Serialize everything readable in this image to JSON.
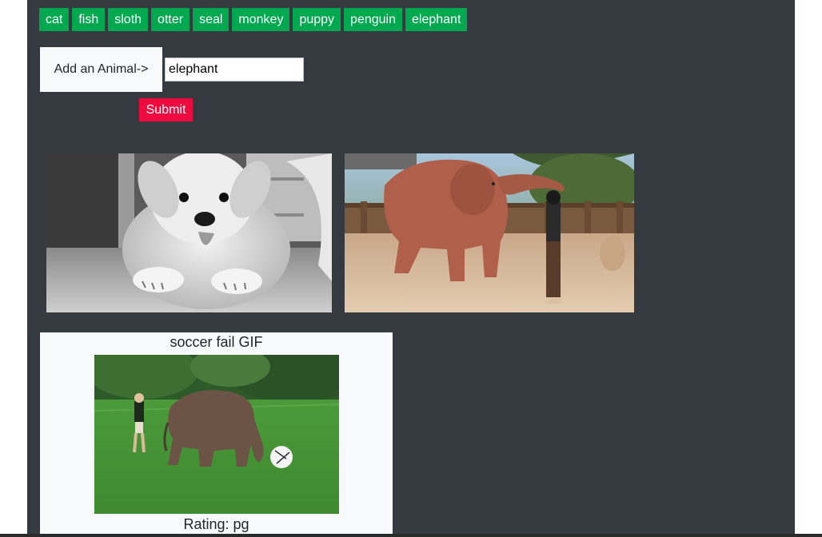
{
  "animal_buttons": [
    "cat",
    "fish",
    "sloth",
    "otter",
    "seal",
    "monkey",
    "puppy",
    "penguin",
    "elephant"
  ],
  "form": {
    "label": "Add an Animal->",
    "input_value": "elephant",
    "submit_label": "Submit"
  },
  "gifs": [
    {
      "subject": "puppy"
    },
    {
      "subject": "elephant"
    }
  ],
  "card": {
    "title": "soccer fail GIF",
    "rating": "Rating: pg"
  },
  "colors": {
    "background": "#343a40",
    "animal_button": "#00a84f",
    "submit_button": "#ee0a3e",
    "card": "#f8f9fa"
  }
}
